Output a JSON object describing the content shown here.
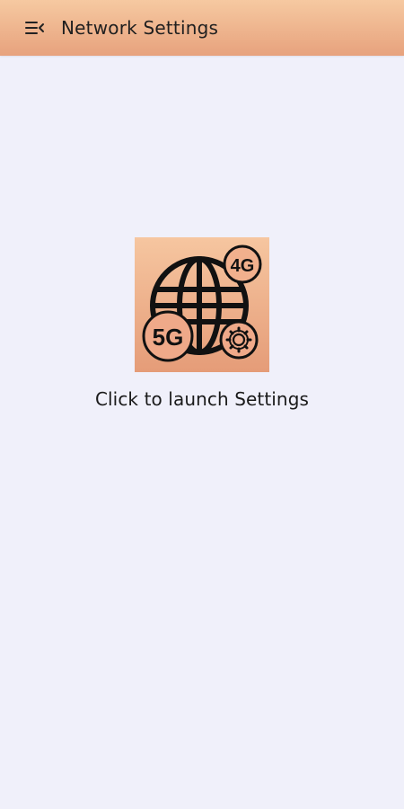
{
  "header": {
    "title": "Network Settings",
    "menu_icon": "menu-collapse-icon"
  },
  "main": {
    "logo": {
      "icon": "globe-network-icon",
      "badge_4g": "4G",
      "badge_5g": "5G",
      "badge_gear": "gear-icon"
    },
    "launch_text": "Click to launch Settings"
  },
  "colors": {
    "accent_top": "#f6c9a1",
    "accent_bottom": "#e7a27d",
    "background": "#f0f0fa",
    "text": "#1a1a1a"
  }
}
